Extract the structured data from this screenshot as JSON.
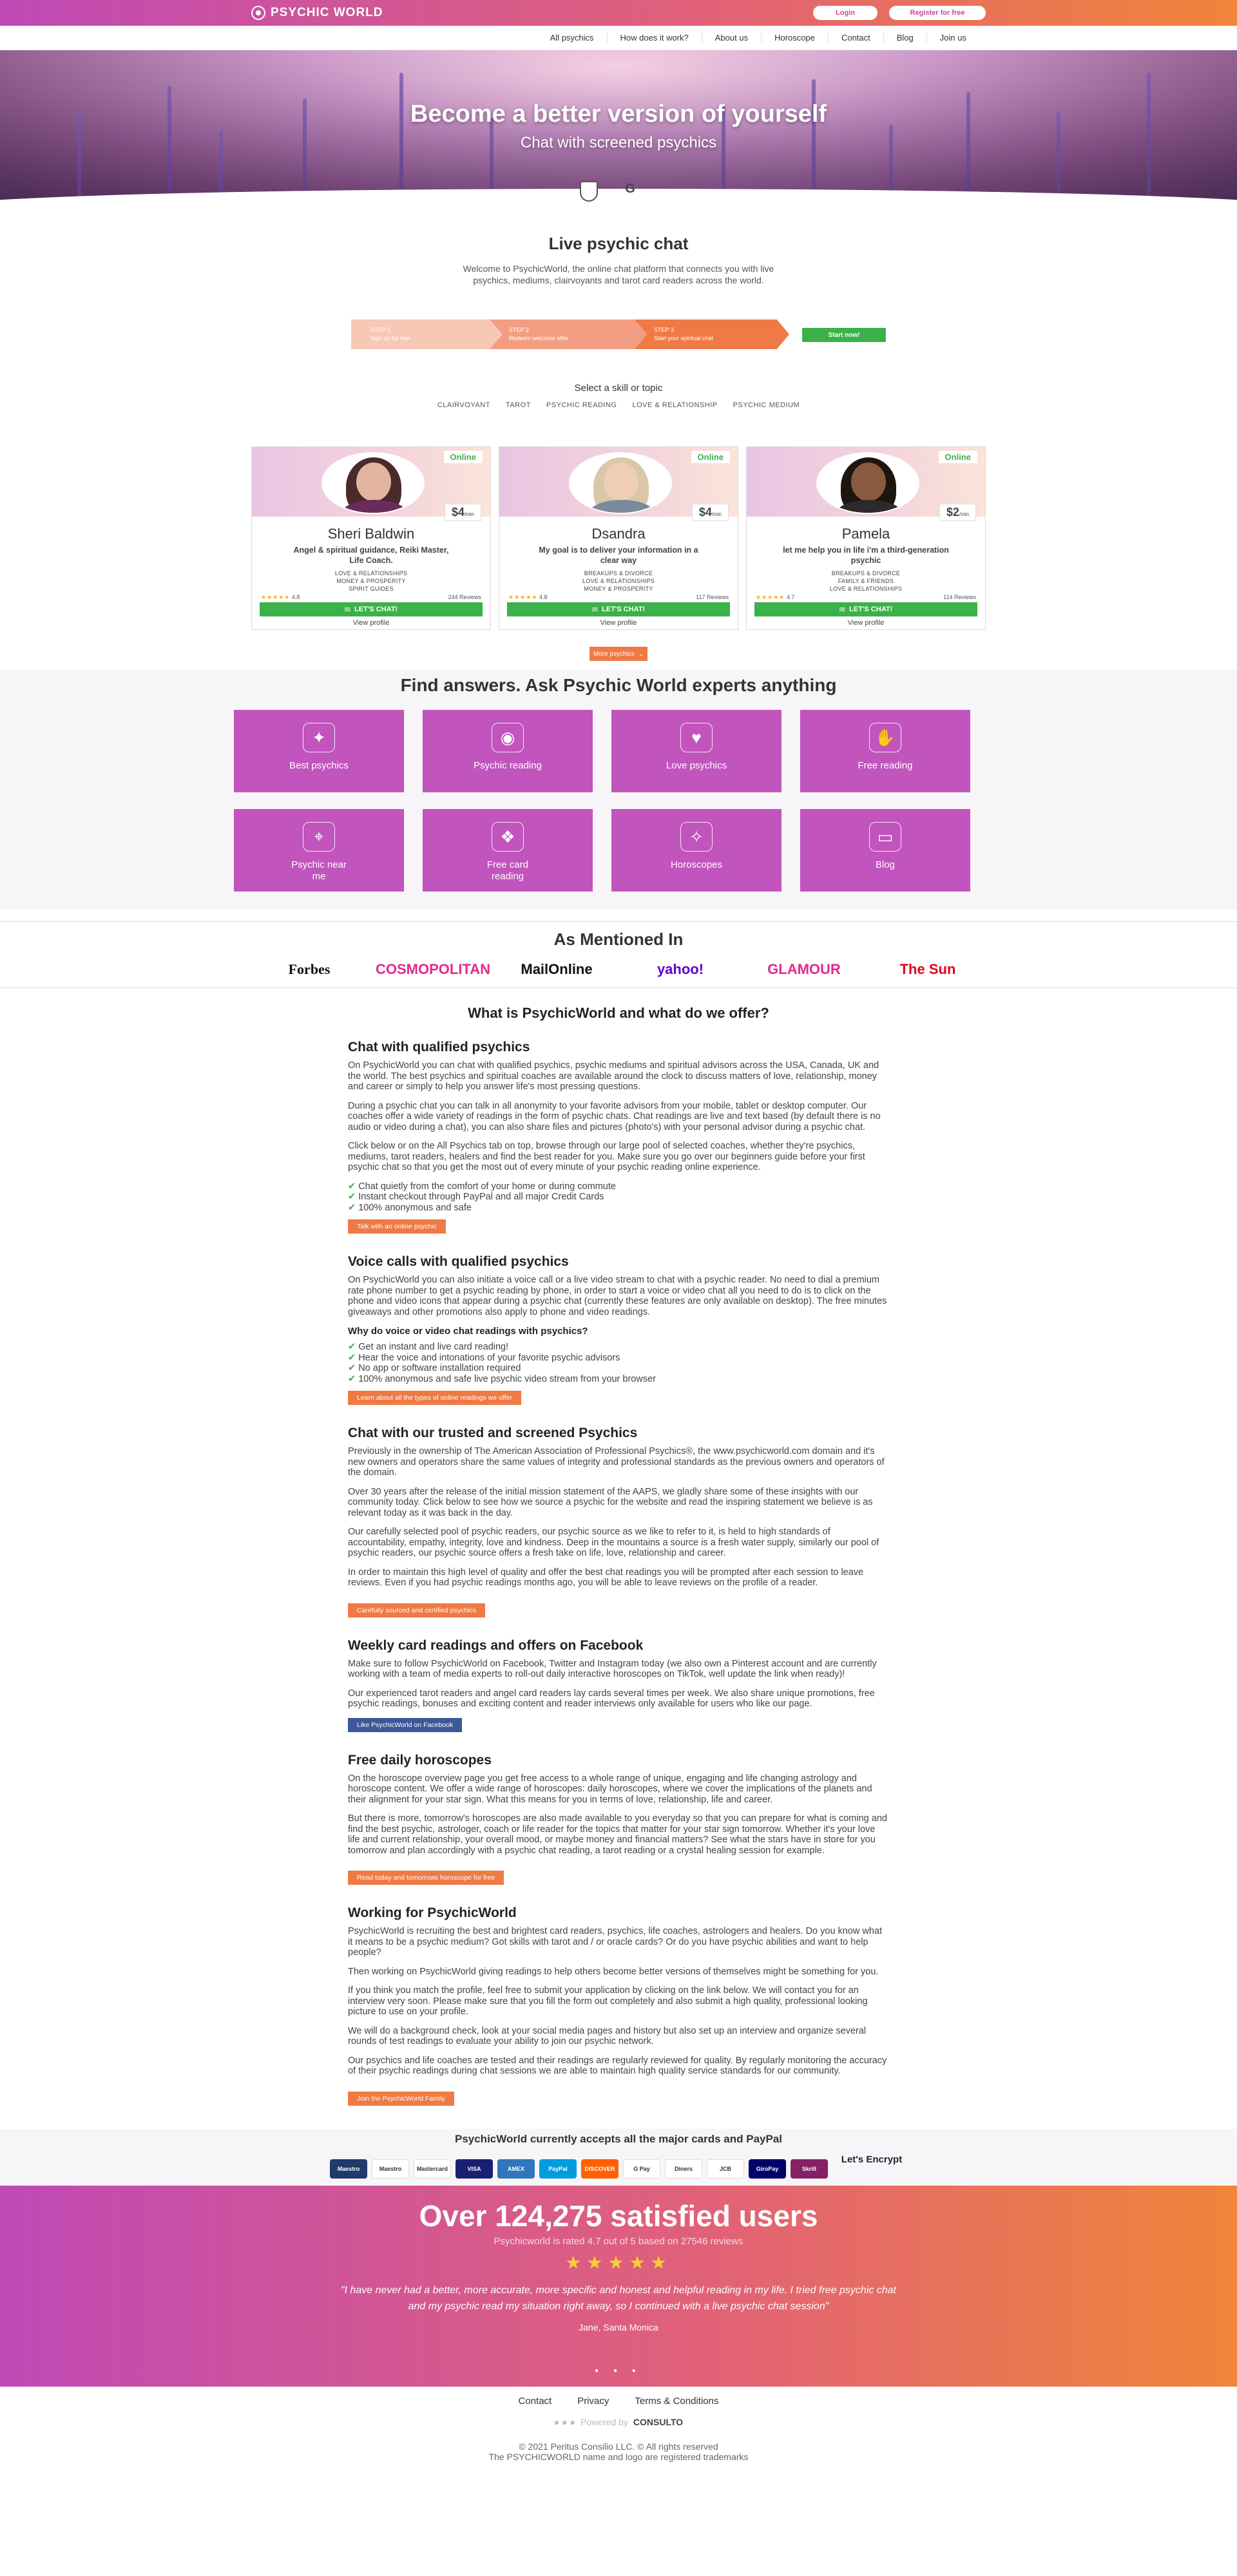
{
  "header": {
    "logo_text": "PSYCHIC WORLD",
    "login_label": "Login",
    "register_label": "Register for free"
  },
  "nav": [
    "All psychics",
    "How does it work?",
    "About us",
    "Horoscope",
    "Contact",
    "Blog",
    "Join us"
  ],
  "hero": {
    "title": "Become a better version of yourself",
    "subtitle": "Chat with screened psychics",
    "badge_g_text": "G"
  },
  "live": {
    "title": "Live psychic chat",
    "description": "Welcome to PsychicWorld, the online chat platform that connects you with live psychics, mediums, clairvoyants and tarot card readers across the world."
  },
  "steps": [
    {
      "label": "STEP 1",
      "text": "Sign up for free"
    },
    {
      "label": "STEP 2",
      "text": "Redeem welcome offer"
    },
    {
      "label": "STEP 3",
      "text": "Start your spiritual chat"
    }
  ],
  "start_label": "Start now!",
  "skills": {
    "title": "Select a skill or topic",
    "items": [
      "CLAIRVOYANT",
      "TAROT",
      "PSYCHIC READING",
      "LOVE & RELATIONSHIP",
      "PSYCHIC MEDIUM"
    ]
  },
  "psychics": [
    {
      "status": "Online",
      "price": "$4",
      "price_unit": "/min",
      "name": "Sheri Baldwin",
      "tagline": "Angel & spiritual guidance, Reiki Master, Life Coach.",
      "specialties": [
        "LOVE & RELATIONSHIPS",
        "MONEY & PROSPERITY",
        "SPIRIT GUIDES"
      ],
      "rating": "4.8",
      "reviews": "244 Reviews",
      "chat_label": "LET'S CHAT!",
      "profile_label": "View profile",
      "hair": "#4a2a2a",
      "skin": "#e3b59e",
      "shirt": "#6b2b5a"
    },
    {
      "status": "Online",
      "price": "$4",
      "price_unit": "/min",
      "name": "Dsandra",
      "tagline": "My goal is to deliver your information in a clear way",
      "specialties": [
        "BREAKUPS & DIVORCE",
        "LOVE & RELATIONSHIPS",
        "MONEY & PROSPERITY"
      ],
      "rating": "4.8",
      "reviews": "117 Reviews",
      "chat_label": "LET'S CHAT!",
      "profile_label": "View profile",
      "hair": "#d9c7a8",
      "skin": "#f0cdb5",
      "shirt": "#7a8a9a"
    },
    {
      "status": "Online",
      "price": "$2",
      "price_unit": "/min",
      "name": "Pamela",
      "tagline": "let me help you in life i'm a third-generation psychic",
      "specialties": [
        "BREAKUPS & DIVORCE",
        "FAMILY & FRIENDS",
        "LOVE & RELATIONSHIPS"
      ],
      "rating": "4.7",
      "reviews": "114 Reviews",
      "chat_label": "LET'S CHAT!",
      "profile_label": "View profile",
      "hair": "#1e1410",
      "skin": "#8a5a3e",
      "shirt": "#2c2a2a"
    }
  ],
  "more_label": "More psychics",
  "find": {
    "title": "Find answers. Ask Psychic World experts anything",
    "tiles": [
      {
        "label": "Best psychics",
        "icon": "crystal-ball-icon",
        "glyph": "✦"
      },
      {
        "label": "Psychic reading",
        "icon": "eye-icon",
        "glyph": "◉"
      },
      {
        "label": "Love psychics",
        "icon": "heart-hands-icon",
        "glyph": "♥"
      },
      {
        "label": "Free reading",
        "icon": "palm-icon",
        "glyph": "✋"
      },
      {
        "label": "Psychic near me",
        "icon": "map-icon",
        "glyph": "⌖"
      },
      {
        "label": "Free card reading",
        "icon": "tarot-cards-icon",
        "glyph": "❖"
      },
      {
        "label": "Horoscopes",
        "icon": "constellation-icon",
        "glyph": "✧"
      },
      {
        "label": "Blog",
        "icon": "laptop-icon",
        "glyph": "▭"
      }
    ]
  },
  "mentioned": {
    "title": "As Mentioned In",
    "press": [
      {
        "name": "Forbes",
        "color": "#111"
      },
      {
        "name": "COSMOPOLITAN",
        "color": "#e4298a"
      },
      {
        "name": "MailOnline",
        "color": "#111"
      },
      {
        "name": "yahoo!",
        "color": "#6001d2"
      },
      {
        "name": "GLAMOUR",
        "color": "#e4298a"
      },
      {
        "name": "The Sun",
        "color": "#e3001b"
      }
    ]
  },
  "article": {
    "title": "What is PsychicWorld and what do we offer?",
    "s1_title": "Chat with qualified psychics",
    "s1_p1": "On PsychicWorld you can chat with qualified psychics, psychic mediums and spiritual advisors across the USA, Canada, UK and the world. The best psychics and spiritual coaches are available around the clock to discuss matters of love, relationship, money and career or simply to help you answer life's most pressing questions.",
    "s1_p2": "During a psychic chat you can talk in all anonymity to your favorite advisors from your mobile, tablet or desktop computer. Our coaches offer a wide variety of readings in the form of psychic chats. Chat readings are live and text based (by default there is no audio or video during a chat), you can also share files and pictures (photo's) with your personal advisor during a psychic chat.",
    "s1_p3": "Click below or on the All Psychics tab on top, browse through our large pool of selected coaches, whether they're psychics, mediums, tarot readers, healers and find the best reader for you. Make sure you go over our beginners guide before your first psychic chat so that you get the most out of every minute of your psychic reading online experience.",
    "s1_checks": [
      "Chat quietly from the comfort of your home or during commute",
      "Instant checkout through PayPal and all major Credit Cards",
      "100% anonymous and safe"
    ],
    "s1_cta": "Talk with an online psychic",
    "s2_title": "Voice calls with qualified psychics",
    "s2_p1": "On PsychicWorld you can also initiate a voice call or a live video stream to chat with a psychic reader. No need to dial a premium rate phone number to get a psychic reading by phone, in order to start a voice or video chat all you need to do is to click on the phone and video icons that appear during a psychic chat (currently these features are only available on desktop). The free minutes giveaways and other promotions also apply to phone and video readings.",
    "s2_sub": "Why do voice or video chat readings with psychics?",
    "s2_checks": [
      "Get an instant and live card reading!",
      "Hear the voice and intonations of your favorite psychic advisors",
      "No app or software installation required",
      "100% anonymous and safe live psychic video stream from your browser"
    ],
    "s2_cta": "Learn about all the types of online readings we offer",
    "s3_title": "Chat with our trusted and screened Psychics",
    "s3_p1": "Previously in the ownership of The American Association of Professional Psychics®, the www.psychicworld.com domain and it's new owners and operators share the same values of integrity and professional standards as the previous owners and operators of the domain.",
    "s3_p2": "Over 30 years after the release of the initial mission statement of the AAPS, we gladly share some of these insights with our community today. Click below to see how we source a psychic for the website and read the inspiring statement we believe is as relevant today as it was back in the day.",
    "s3_p3": "Our carefully selected pool of psychic readers, our psychic source as we like to refer to it, is held to high standards of accountability, empathy, integrity, love and kindness. Deep in the mountains a source is a fresh water supply, similarly our pool of psychic readers, our psychic source offers a fresh take on life, love, relationship and career.",
    "s3_p4": "In order to maintain this high level of quality and offer the best chat readings you will be prompted after each session to leave reviews. Even if you had psychic readings months ago, you will be able to leave reviews on the profile of a reader.",
    "s3_cta": "Carefully sourced and certified psychics",
    "s4_title": "Weekly card readings and offers on Facebook",
    "s4_p1": "Make sure to follow PsychicWorld on Facebook, Twitter and Instagram today (we also own a Pinterest account and are currently working with a team of media experts to roll-out daily interactive horoscopes on TikTok, well update the link when ready)!",
    "s4_p2": "Our experienced tarot readers and angel card readers lay cards several times per week. We also share unique promotions, free psychic readings, bonuses and exciting content and reader interviews only available for users who like our page.",
    "s4_cta": "Like PsychicWorld on Facebook",
    "s5_title": "Free daily horoscopes",
    "s5_p1": "On the horoscope overview page you get free access to a whole range of unique, engaging and life changing astrology and horoscope content. We offer a wide range of horoscopes: daily horoscopes, where we cover the implications of the planets and their alignment for your star sign. What this means for you in terms of love, relationship, life and career.",
    "s5_p2": "But there is more, tomorrow's horoscopes are also made available to you everyday so that you can prepare for what is coming and find the best psychic, astrologer, coach or life reader for the topics that matter for your star sign tomorrow. Whether it's your love life and current relationship, your overall mood, or maybe money and financial matters? See what the stars have in store for you tomorrow and plan accordingly with a psychic chat reading, a tarot reading or a crystal healing session for example.",
    "s5_cta": "Read today and tomorrows horoscope for free",
    "s6_title": "Working for PsychicWorld",
    "s6_p1": "PsychicWorld is recruiting the best and brightest card readers, psychics, life coaches, astrologers and healers. Do you know what it means to be a psychic medium? Got skills with tarot and / or oracle cards? Or do you have psychic abilities and want to help people?",
    "s6_p2": "Then working on PsychicWorld giving readings to help others become better versions of themselves might be something for you.",
    "s6_p3": "If you think you match the profile, feel free to submit your application by clicking on the link below. We will contact you for an interview very soon. Please make sure that you fill the form out completely and also submit a high quality, professional looking picture to use on your profile.",
    "s6_p4": "We will do a background check, look at your social media pages and history but also set up an interview and organize several rounds of test readings to evaluate your ability to join our psychic network.",
    "s6_p5": "Our psychics and life coaches are tested and their readings are regularly reviewed for quality. By regularly monitoring the accuracy of their psychic readings during chat sessions we are able to maintain high quality service standards for our community.",
    "s6_cta": "Join the PsychicWorld Family"
  },
  "payments": {
    "title": "PsychicWorld currently accepts all the major cards and PayPal",
    "methods": [
      {
        "name": "Maestro",
        "color": "#1f3a6b"
      },
      {
        "name": "Maestro",
        "color": "#ffffff"
      },
      {
        "name": "Mastercard",
        "color": "#ffffff"
      },
      {
        "name": "VISA",
        "color": "#1a1f71"
      },
      {
        "name": "AMEX",
        "color": "#2e77bc"
      },
      {
        "name": "PayPal",
        "color": "#009cde"
      },
      {
        "name": "DISCOVER",
        "color": "#ff6000"
      },
      {
        "name": "G Pay",
        "color": "#ffffff"
      },
      {
        "name": "Diners",
        "color": "#ffffff"
      },
      {
        "name": "JCB",
        "color": "#ffffff"
      },
      {
        "name": "GiroPay",
        "color": "#000268"
      },
      {
        "name": "Skrill",
        "color": "#862165"
      }
    ],
    "letsencrypt": "Let's Encrypt"
  },
  "satisfied": {
    "title": "Over 124,275 satisfied users",
    "subtitle": "Psychicworld is rated 4.7 out of 5 based on 27546 reviews",
    "stars": "★★★★★",
    "quote": "\"I have never had a better, more accurate, more specific and honest and helpful reading in my life. I tried free psychic chat and my psychic read my situation right away, so I continued with a live psychic chat session\"",
    "author": "Jane, Santa Monica"
  },
  "footer": {
    "links": [
      "Contact",
      "Privacy",
      "Terms & Conditions"
    ],
    "powered_label": "Powered by",
    "powered_brand": "CONSULTO",
    "copyright": "© 2021 Peritus Consilio LLC. © All rights reserved",
    "trademark": "The PSYCHICWORLD name and logo are registered trademarks"
  }
}
